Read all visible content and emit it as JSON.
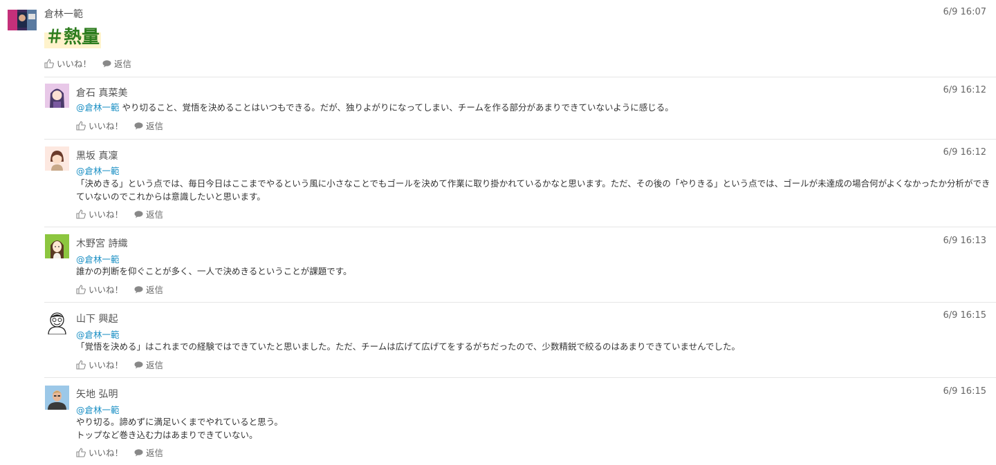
{
  "post": {
    "author": "倉林一範",
    "time": "6/9 16:07",
    "hashtag": "＃熱量",
    "like_label": "いいね！",
    "reply_label": "返信"
  },
  "comments": [
    {
      "author": "倉石 真菜美",
      "time": "6/9 16:12",
      "mention": "@倉林一範",
      "text": "やり切ること、覚悟を決めることはいつもできる。だが、独りよがりになってしまい、チームを作る部分があまりできていないように感じる。",
      "like_label": "いいね！",
      "reply_label": "返信"
    },
    {
      "author": "黒坂 真凜",
      "time": "6/9 16:12",
      "mention": "@倉林一範",
      "text_line1": "「決めきる」という点では、毎日今日はここまでやるという風に小さなことでもゴールを決めて作業に取り掛かれているかなと思います。ただ、その後の「やりきる」という点では、ゴールが未達成の場合何がよくなかったか分析ができ",
      "text_line2": "ていないのでこれからは意識したいと思います。",
      "like_label": "いいね！",
      "reply_label": "返信"
    },
    {
      "author": "木野宮 詩織",
      "time": "6/9 16:13",
      "mention": "@倉林一範",
      "text": "誰かの判断を仰ぐことが多く、一人で決めきるということが課題です。",
      "like_label": "いいね！",
      "reply_label": "返信"
    },
    {
      "author": "山下 興起",
      "time": "6/9 16:15",
      "mention": "@倉林一範",
      "text": "「覚悟を決める」はこれまでの経験ではできていたと思いました。ただ、チームは広げて広げてをするがちだったので、少数精鋭で絞るのはあまりできていませんでした。",
      "like_label": "いいね！",
      "reply_label": "返信"
    },
    {
      "author": "矢地 弘明",
      "time": "6/9 16:15",
      "mention": "@倉林一範",
      "text_line1": "やり切る。諦めずに満足いくまでやれていると思う。",
      "text_line2": "トップなど巻き込む力はあまりできていない。",
      "like_label": "いいね！",
      "reply_label": "返信"
    }
  ],
  "colors": {
    "mention": "#1a8fc4",
    "hashtag": "#2e7d1f",
    "hashtag_highlight": "#fff3cc"
  },
  "icons": {
    "like": "thumbs-up-icon",
    "reply": "speech-bubble-icon"
  }
}
